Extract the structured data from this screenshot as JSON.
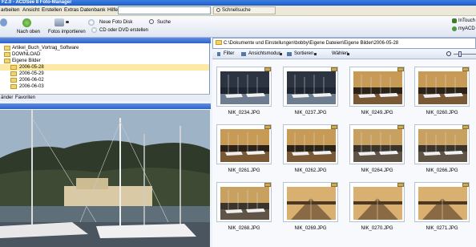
{
  "title_bar": {
    "text": "FZ.0 - ACDSee 8 Foto-Manager"
  },
  "menu": {
    "items": [
      "arbeiten",
      "Ansicht",
      "Erstellen",
      "Extras",
      "Datenbank",
      "Hilfe"
    ],
    "quick_search_label": "Schnellsuche"
  },
  "toolbar": {
    "nach_oben": "Nach oben",
    "fotos_importieren": "Fotos importieren",
    "neue_foto_disk": "Neue Foto Disk",
    "cd_oder_dvd": "CD oder DVD erstellen",
    "suche": "Suche",
    "intouch": "InTouch",
    "myacd": "myACD"
  },
  "folders": {
    "items": [
      {
        "label": "Artikel_Buch_Vortrag_Software",
        "selected": false
      },
      {
        "label": "DOWNLOAD",
        "selected": false
      },
      {
        "label": "Eigene Bilder",
        "selected": false
      },
      {
        "label": "2006-05-28",
        "selected": true
      },
      {
        "label": "2006-05-29",
        "selected": false
      },
      {
        "label": "2006-06-02",
        "selected": false
      },
      {
        "label": "2006-06-03",
        "selected": false
      }
    ]
  },
  "tabs": {
    "labels": [
      "änder",
      "Favoriten"
    ]
  },
  "browser": {
    "path": "C:\\Dokumente und Einstellungen\\bobby\\Eigene Dateien\\Eigene Bilder\\2006-05-28",
    "filter_label": "Filter",
    "view_label": "Ansichtsmodus",
    "sort_label": "Sortieren",
    "select_label": "Wählen",
    "files": [
      {
        "name": "NIK_0234.JPG",
        "scene": "harbor-dusk"
      },
      {
        "name": "NIK_0237.JPG",
        "scene": "harbor-dusk"
      },
      {
        "name": "NIK_0249.JPG",
        "scene": "harbor-sunset"
      },
      {
        "name": "NIK_0260.JPG",
        "scene": "harbor-sunset"
      },
      {
        "name": "NIK_0261.JPG",
        "scene": "harbor-sunset"
      },
      {
        "name": "NIK_0262.JPG",
        "scene": "harbor-sunset"
      },
      {
        "name": "NIK_0264.JPG",
        "scene": "harbor-boats"
      },
      {
        "name": "NIK_0266.JPG",
        "scene": "harbor-boats"
      },
      {
        "name": "NIK_0268.JPG",
        "scene": "harbor-boats"
      },
      {
        "name": "NIK_0269.JPG",
        "scene": "pier"
      },
      {
        "name": "NIK_0270.JPG",
        "scene": "pier"
      },
      {
        "name": "NIK_0271.JPG",
        "scene": "pier"
      }
    ]
  },
  "colors": {
    "accent": "#2e62c9",
    "selection": "#fbe9a5"
  }
}
